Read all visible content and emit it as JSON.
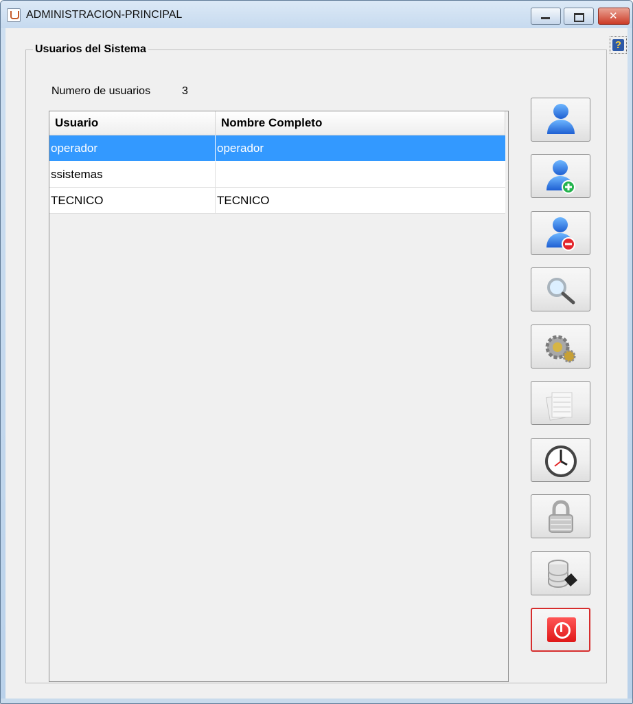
{
  "window": {
    "title": "ADMINISTRACION-PRINCIPAL"
  },
  "group": {
    "title": "Usuarios del Sistema"
  },
  "user_count": {
    "label": "Numero de usuarios",
    "value": "3"
  },
  "table": {
    "columns": [
      "Usuario",
      "Nombre Completo"
    ],
    "rows": [
      {
        "usuario": "operador",
        "nombre_completo": "operador",
        "selected": true
      },
      {
        "usuario": "ssistemas",
        "nombre_completo": "",
        "selected": false
      },
      {
        "usuario": "TECNICO",
        "nombre_completo": "TECNICO",
        "selected": false
      }
    ]
  },
  "actions": [
    {
      "icon": "user-icon"
    },
    {
      "icon": "user-add-icon"
    },
    {
      "icon": "user-remove-icon"
    },
    {
      "icon": "magnifier-icon"
    },
    {
      "icon": "settings-gears-icon"
    },
    {
      "icon": "documents-icon"
    },
    {
      "icon": "clock-icon"
    },
    {
      "icon": "lock-icon"
    },
    {
      "icon": "database-save-icon"
    },
    {
      "icon": "power-icon"
    }
  ],
  "colors": {
    "selection": "#3399ff",
    "power_red": "#df1717"
  }
}
